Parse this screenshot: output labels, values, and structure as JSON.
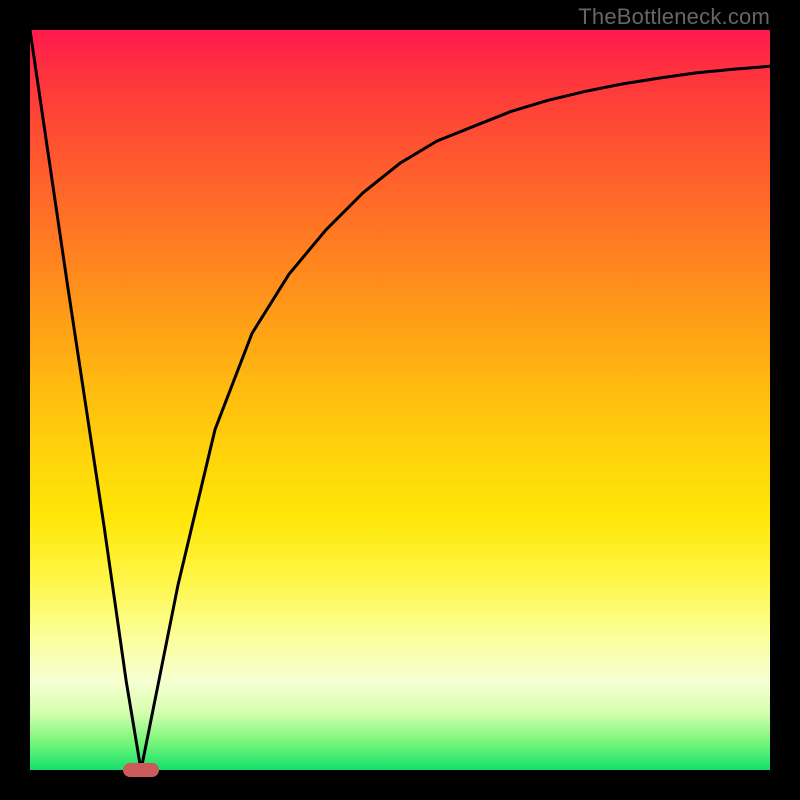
{
  "watermark": "TheBottleneck.com",
  "chart_data": {
    "type": "line",
    "title": "",
    "xlabel": "",
    "ylabel": "",
    "xlim": [
      0,
      100
    ],
    "ylim": [
      0,
      100
    ],
    "series": [
      {
        "name": "bottleneck-curve",
        "x": [
          0,
          5,
          10,
          13,
          15,
          17,
          20,
          25,
          30,
          35,
          40,
          45,
          50,
          55,
          60,
          65,
          70,
          75,
          80,
          85,
          90,
          95,
          100
        ],
        "values": [
          100,
          66,
          33,
          12,
          0,
          10,
          25,
          46,
          59,
          67,
          73,
          78,
          82,
          85,
          87,
          89,
          90.5,
          91.7,
          92.7,
          93.5,
          94.2,
          94.7,
          95.1
        ]
      }
    ],
    "marker": {
      "x": 15,
      "y": 0
    },
    "gradient_stops": [
      {
        "pos": 0,
        "color": "#ff1a4d"
      },
      {
        "pos": 50,
        "color": "#ffd50a"
      },
      {
        "pos": 85,
        "color": "#fcff9a"
      },
      {
        "pos": 100,
        "color": "#14e06a"
      }
    ]
  }
}
